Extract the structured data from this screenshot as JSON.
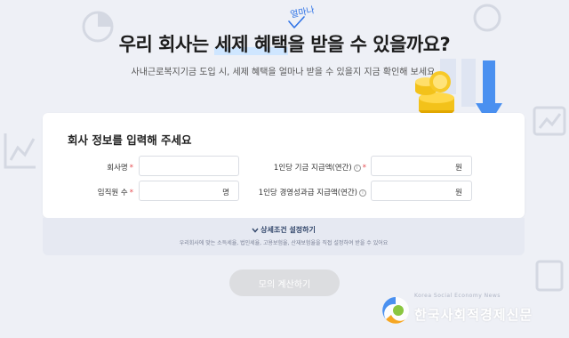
{
  "hero": {
    "headline_part1": "우리 회사는 ",
    "headline_highlight": "세제 혜택",
    "headline_part2": "을 받을 수 있을까요?",
    "annotation": "얼마나",
    "subtitle": "사내근로복지기금 도입 시, 세제 혜택을 얼마나 받을 수 있을지 지금 확인해 보세요."
  },
  "form": {
    "title": "회사 정보를 입력해 주세요",
    "company_name_label": "회사명",
    "employees_label": "임직원 수",
    "employees_unit": "명",
    "fund_per_person_label": "1인당 기금 지급액(연간)",
    "fund_per_person_unit": "원",
    "bonus_per_person_label": "1인당 경영성과급 지급액(연간)",
    "bonus_per_person_unit": "원",
    "required_mark": "*",
    "info_mark": "i",
    "company_name_value": "",
    "employees_value": "",
    "fund_value": "",
    "bonus_value": ""
  },
  "advanced": {
    "toggle_label": "상세조건 설정하기",
    "toggle_icon": "chevron-down-icon",
    "note": "우리회사에 맞는 소득세율, 법인세율, 고용보험율, 산재보험율을 직접 설정하여 받을 수 있어요"
  },
  "calculate_button": "모의 계산하기",
  "logo": {
    "name": "한국사회적경제신문",
    "tagline": "Korea Social Economy News"
  },
  "colors": {
    "background": "#eef0f6",
    "accent_blue": "#2f73e6",
    "required_red": "#e5484d",
    "button_disabled": "#dcdde0"
  }
}
